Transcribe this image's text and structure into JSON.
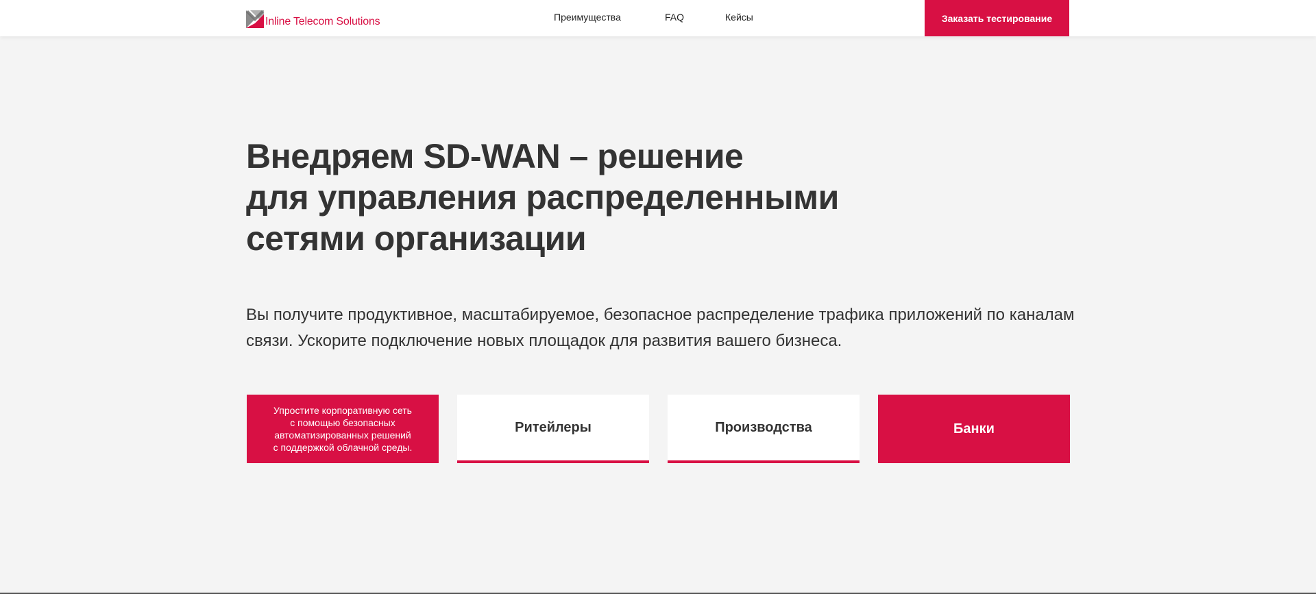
{
  "header": {
    "logo_text": "Inline Telecom Solutions",
    "nav": [
      "Преимущества",
      "FAQ",
      "Кейсы"
    ],
    "cta_label": "Заказать тестирование"
  },
  "hero": {
    "title_lines": [
      "Внедряем SD-WAN – решение",
      "для управления распределенными",
      "сетями организации"
    ],
    "subtitle_lines": [
      "Вы получите продуктивное, масштабируемое, безопасное распределение трафика приложений по каналам",
      "связи. Ускорите подключение новых площадок для развития вашего бизнеса."
    ]
  },
  "cards": {
    "intro_lines": [
      "Упростите корпоративную сеть",
      "с помощью безопасных",
      "автоматизированных решений",
      "с поддержкой облачной среды."
    ],
    "items": [
      "Ритейлеры",
      "Производства",
      "Банки"
    ]
  },
  "colors": {
    "accent": "#d81044",
    "background": "#f4f4f4",
    "text": "#333333"
  }
}
